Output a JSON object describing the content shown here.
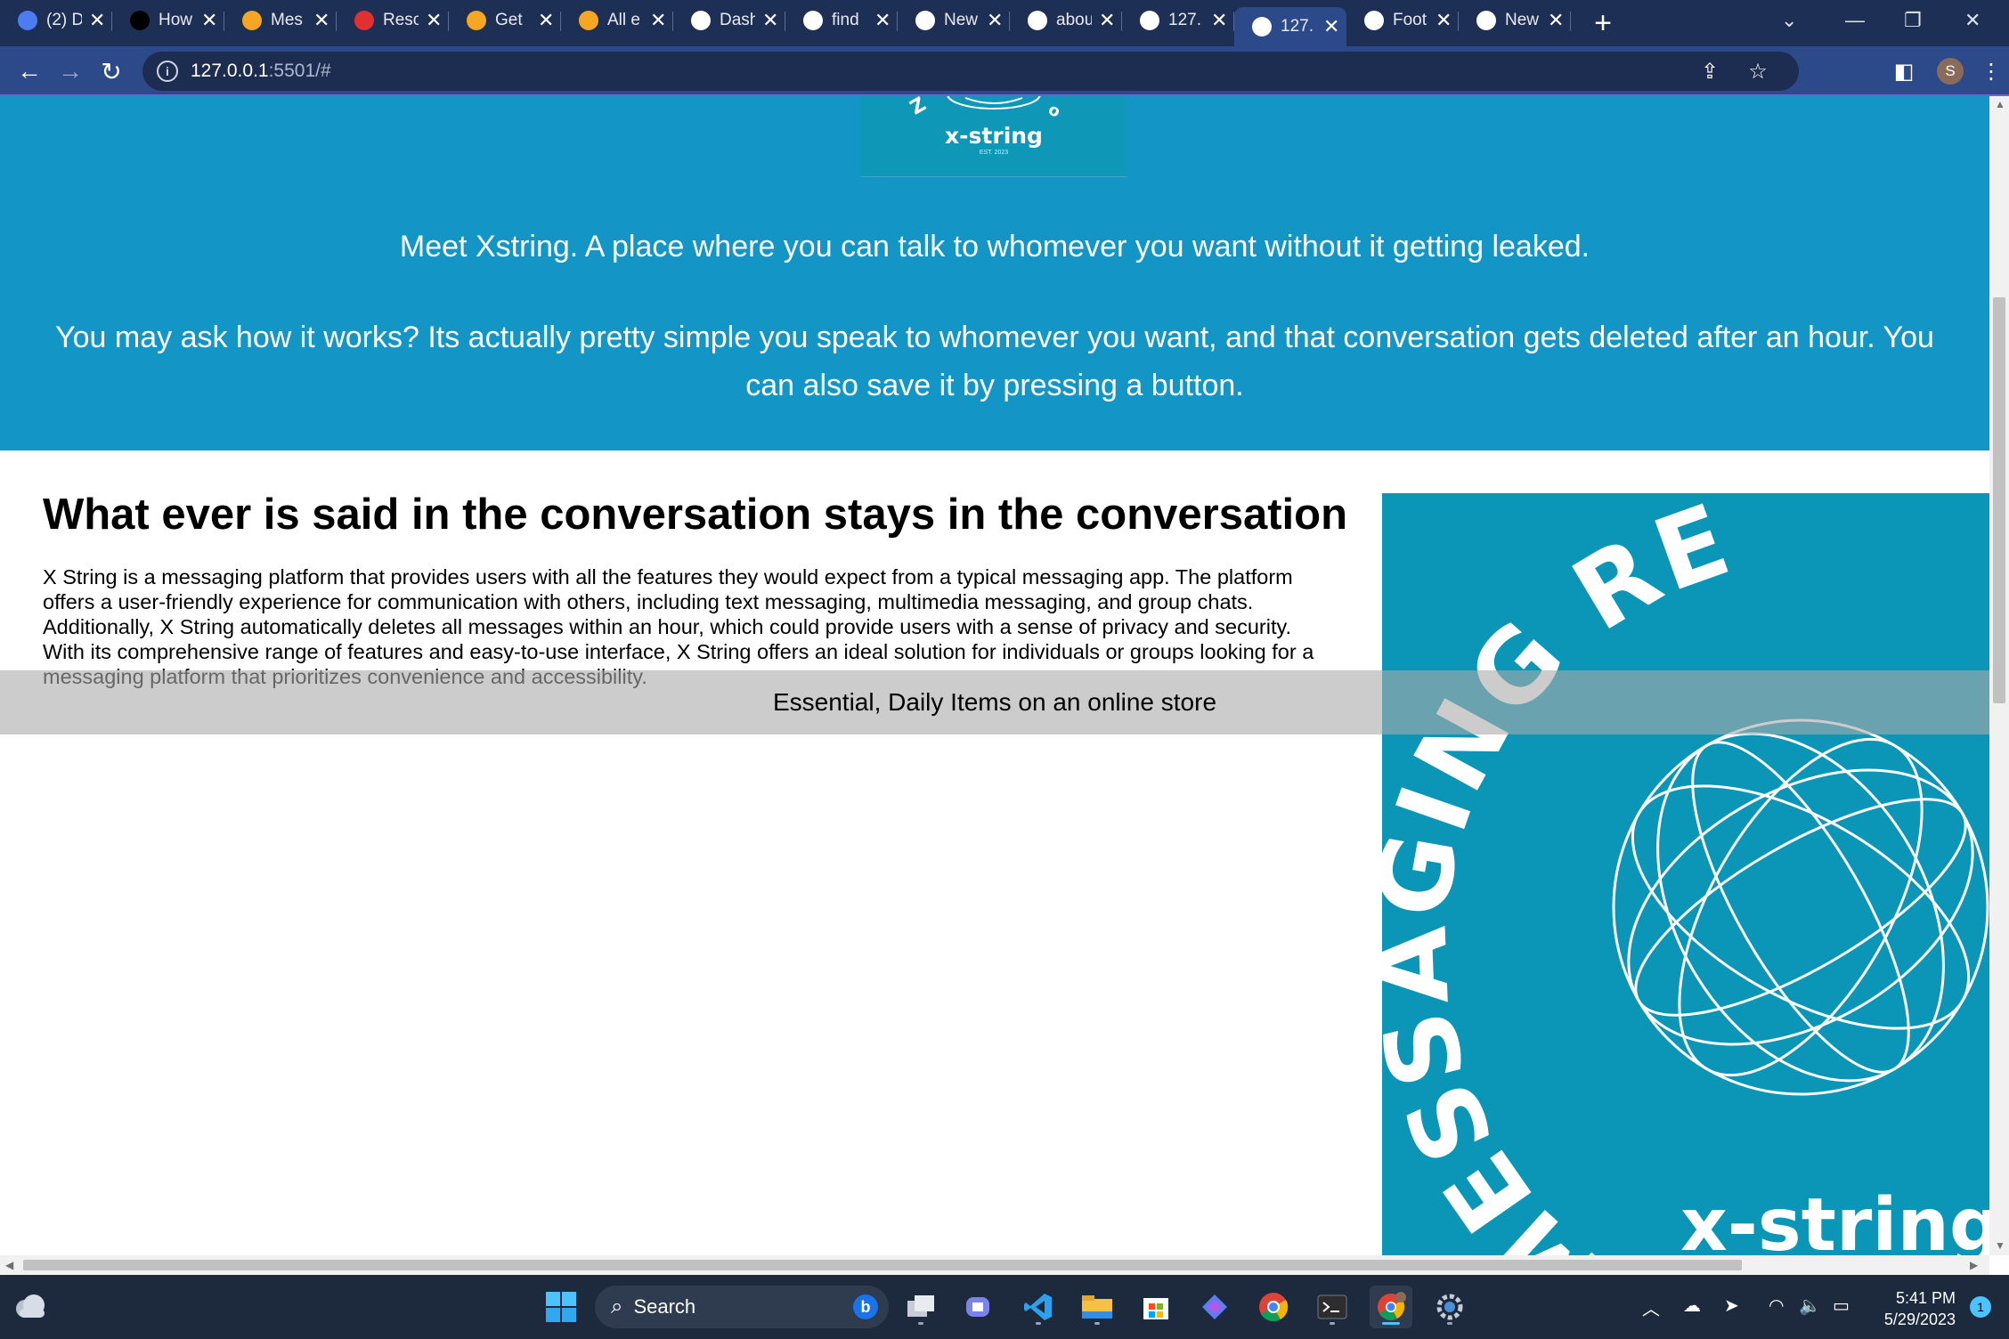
{
  "browser": {
    "tabs": [
      {
        "label": "(2) D",
        "favicon": "notification-badge-icon",
        "color": "#4c7cf0"
      },
      {
        "label": "How",
        "favicon": "dev-logo-icon",
        "color": "#000000"
      },
      {
        "label": "Mes",
        "favicon": "firebase-icon",
        "color": "#f5a623"
      },
      {
        "label": "Reso",
        "favicon": "red-logo-icon",
        "color": "#e03030"
      },
      {
        "label": "Get",
        "favicon": "firebase-icon",
        "color": "#f5a623"
      },
      {
        "label": "All e",
        "favicon": "firebase-icon",
        "color": "#f5a623"
      },
      {
        "label": "Dash",
        "favicon": "globe-icon",
        "color": "#ffffff"
      },
      {
        "label": "find",
        "favicon": "google-icon",
        "color": "#ffffff"
      },
      {
        "label": "New",
        "favicon": "chrome-icon",
        "color": "#ffffff"
      },
      {
        "label": "abou",
        "favicon": "microsoft-icon",
        "color": "#ffffff"
      },
      {
        "label": "127.",
        "favicon": "globe-icon",
        "color": "#ffffff"
      },
      {
        "label": "127.",
        "favicon": "globe-icon",
        "color": "#ffffff",
        "active": true
      },
      {
        "label": "Foot",
        "favicon": "openai-icon",
        "color": "#ffffff"
      },
      {
        "label": "New",
        "favicon": "chrome-icon",
        "color": "#ffffff"
      }
    ],
    "new_tab_symbol": "+",
    "url_host": "127.0.0.1",
    "url_rest": ":5501/#",
    "profile_initial": "S",
    "colors": {
      "tabstrip": "#1e2f55",
      "toolbar": "#2c4a8a"
    }
  },
  "page": {
    "logo_text": "x-string",
    "logo_est": "EST. 2023",
    "hero_line1": "Meet Xstring. A place where you can talk to whomever you want without it getting leaked.",
    "hero_line2": "You may ask how it works? Its actually pretty simple you speak to whomever you want, and that conversation gets deleted after an hour. You can also save it by pressing a button.",
    "section_heading": "What ever is said in the conversation stays in the conversation",
    "section_body": "X String is a messaging platform that provides users with all the features they would expect from a typical messaging app. The platform offers a user-friendly experience for communication with others, including text messaging, multimedia messaging, and group chats. Additionally, X String automatically deletes all messages within an hour, which could provide users with a sense of privacy and security. With its comprehensive range of features and easy-to-use interface, X String offers an ideal solution for individuals or groups looking for a messaging platform that prioritizes convenience and accessibility.",
    "banner_text": "Essential, Daily Items on an online store",
    "side_logo_arc_text": "MESSAGING RE",
    "side_logo_wordmark": "x-string",
    "colors": {
      "hero": "#1396c6",
      "side_graphic": "#0b96b7"
    }
  },
  "taskbar": {
    "search_placeholder": "Search",
    "time": "5:41 PM",
    "date": "5/29/2023",
    "notification_count": "1"
  }
}
